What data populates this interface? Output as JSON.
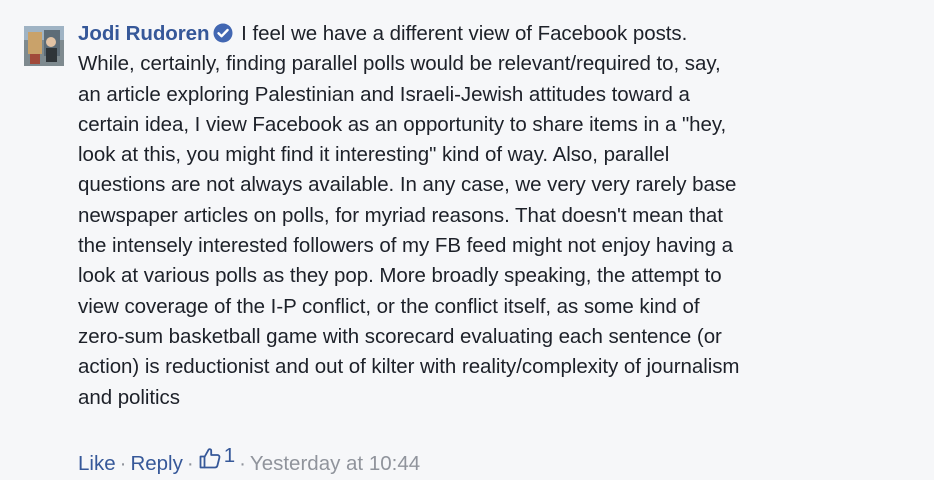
{
  "comment": {
    "author": "Jodi Rudoren",
    "first_line_text": "I feel we have a different view of Facebook posts.",
    "lines": [
      "While, certainly, finding parallel polls would be relevant/required to, say,",
      "an article exploring Palestinian and Israeli-Jewish attitudes toward a",
      "certain idea, I view Facebook as an opportunity to share items in a \"hey,",
      "look at this, you might find it interesting\" kind of way. Also, parallel",
      "questions are not always available. In any case, we very very rarely base",
      "newspaper articles on polls, for myriad reasons. That doesn't mean that",
      "the intensely interested followers of my FB feed might not enjoy having a",
      "look at various polls as they pop. More broadly speaking, the attempt to",
      "view coverage of the I-P conflict, or the conflict itself, as some kind of",
      "zero-sum basketball game with scorecard evaluating each sentence (or",
      "action) is reductionist and out of kilter with reality/complexity of journalism",
      "and politics"
    ],
    "actions": {
      "like_label": "Like",
      "reply_label": "Reply",
      "separator": "·",
      "like_count": "1",
      "timestamp": "Yesterday at 10:44"
    }
  },
  "colors": {
    "background": "#f6f7f9",
    "link": "#365899",
    "text": "#1d2129",
    "muted": "#90949c",
    "verified_badge": "#4267b2"
  },
  "icons": {
    "verified": "verified-badge-icon",
    "like": "thumbs-up-icon",
    "avatar": "profile-avatar"
  }
}
